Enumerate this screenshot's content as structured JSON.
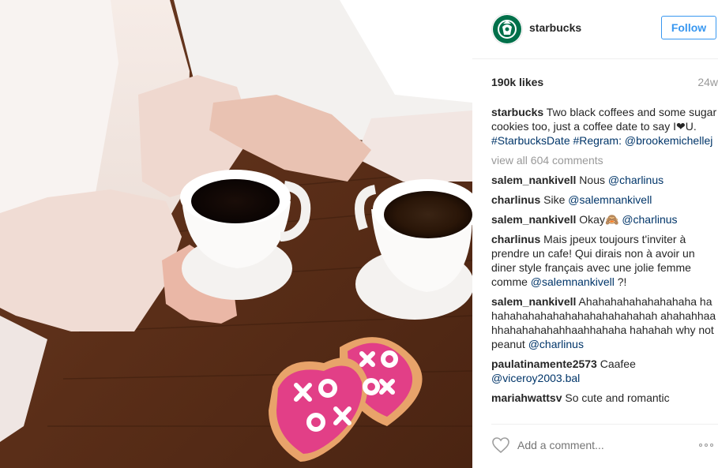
{
  "post": {
    "username": "starbucks",
    "follow_label": "Follow",
    "likes": "190k likes",
    "age": "24w",
    "caption": {
      "user": "starbucks",
      "text": "Two black coffees and some sugar cookies too, just a coffee date to say I",
      "text2": "U.",
      "hashtag1": "#StarbucksDate",
      "hashtag2": "#Regram:",
      "mention": "@brookemichellej"
    },
    "view_all": "view all 604 comments",
    "comments": [
      {
        "user": "salem_nankivell",
        "text": "Nous",
        "mention": "@charlinus"
      },
      {
        "user": "charlinus",
        "text": "Sike",
        "mention": "@salemnankivell"
      },
      {
        "user": "salem_nankivell",
        "text": "Okay",
        "emoji": "🙈",
        "mention": "@charlinus"
      },
      {
        "user": "charlinus",
        "text": "Mais jpeux toujours t'inviter à prendre un cafe! Qui dirais non à avoir un diner style français avec une jolie femme comme",
        "mention": "@salemnankivell",
        "tail": "?!"
      },
      {
        "user": "salem_nankivell",
        "text": "Ahahahahahahahahaha hahahahahahahahahahahahahahah ahahahhaahhahahahahahhaahhahaha hahahah why not peanut",
        "mention": "@charlinus"
      },
      {
        "user": "paulatinamente2573",
        "text": "Caafee",
        "mention": "@viceroy2003.bal"
      },
      {
        "user": "mariahwattsv",
        "text": "So cute and romantic"
      }
    ],
    "add_comment_placeholder": "Add a comment...",
    "icons": {
      "avatar": "starbucks-logo",
      "like": "heart-icon",
      "more": "ellipsis-icon",
      "caption_heart": "heart-emoji"
    },
    "colors": {
      "accent": "#3897f0",
      "link": "#003569",
      "muted": "#999999",
      "brand_green": "#00704a"
    }
  }
}
